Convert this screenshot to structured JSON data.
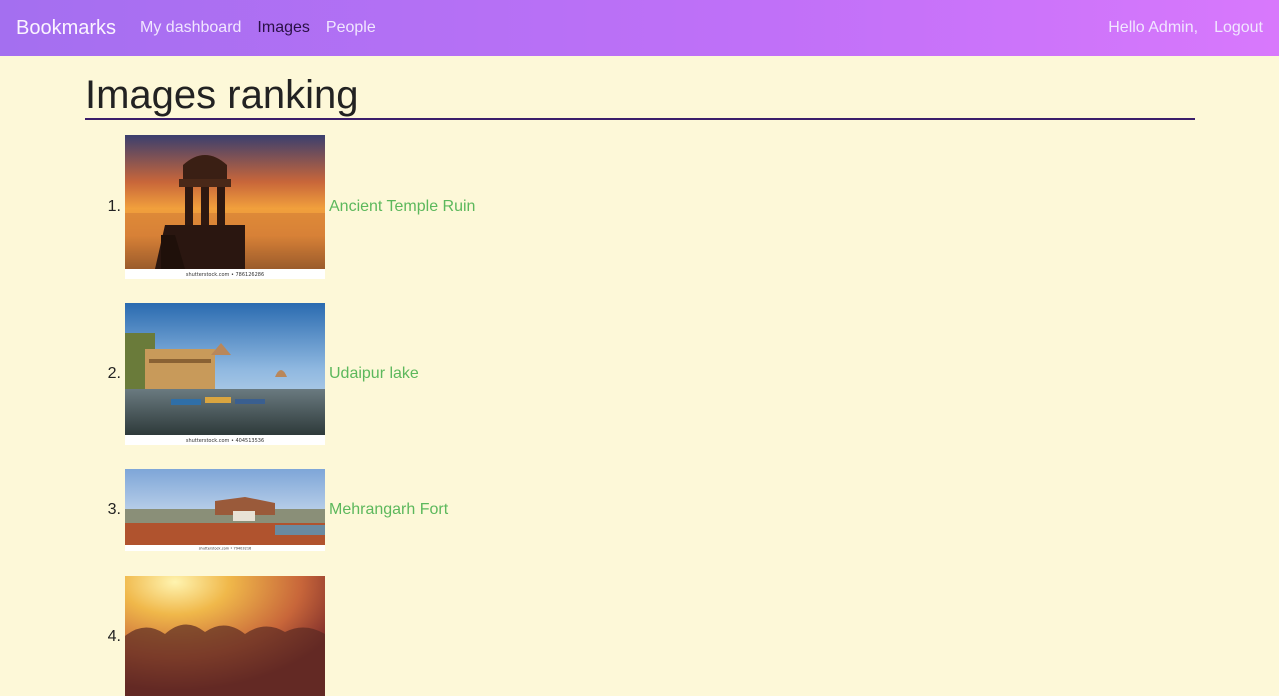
{
  "nav": {
    "brand": "Bookmarks",
    "links": [
      "My dashboard",
      "Images",
      "People"
    ],
    "greeting": "Hello Admin,",
    "logout": "Logout"
  },
  "page": {
    "title": "Images ranking"
  },
  "ranking": [
    {
      "num": "1.",
      "title": "Ancient Temple Ruin",
      "caption": "shutterstock.com • 786126286"
    },
    {
      "num": "2.",
      "title": "Udaipur lake",
      "caption": "shutterstock.com • 404513536"
    },
    {
      "num": "3.",
      "title": "Mehrangarh Fort",
      "caption": "shutterstock.com • 79403216"
    },
    {
      "num": "4.",
      "title": "",
      "caption": ""
    }
  ]
}
